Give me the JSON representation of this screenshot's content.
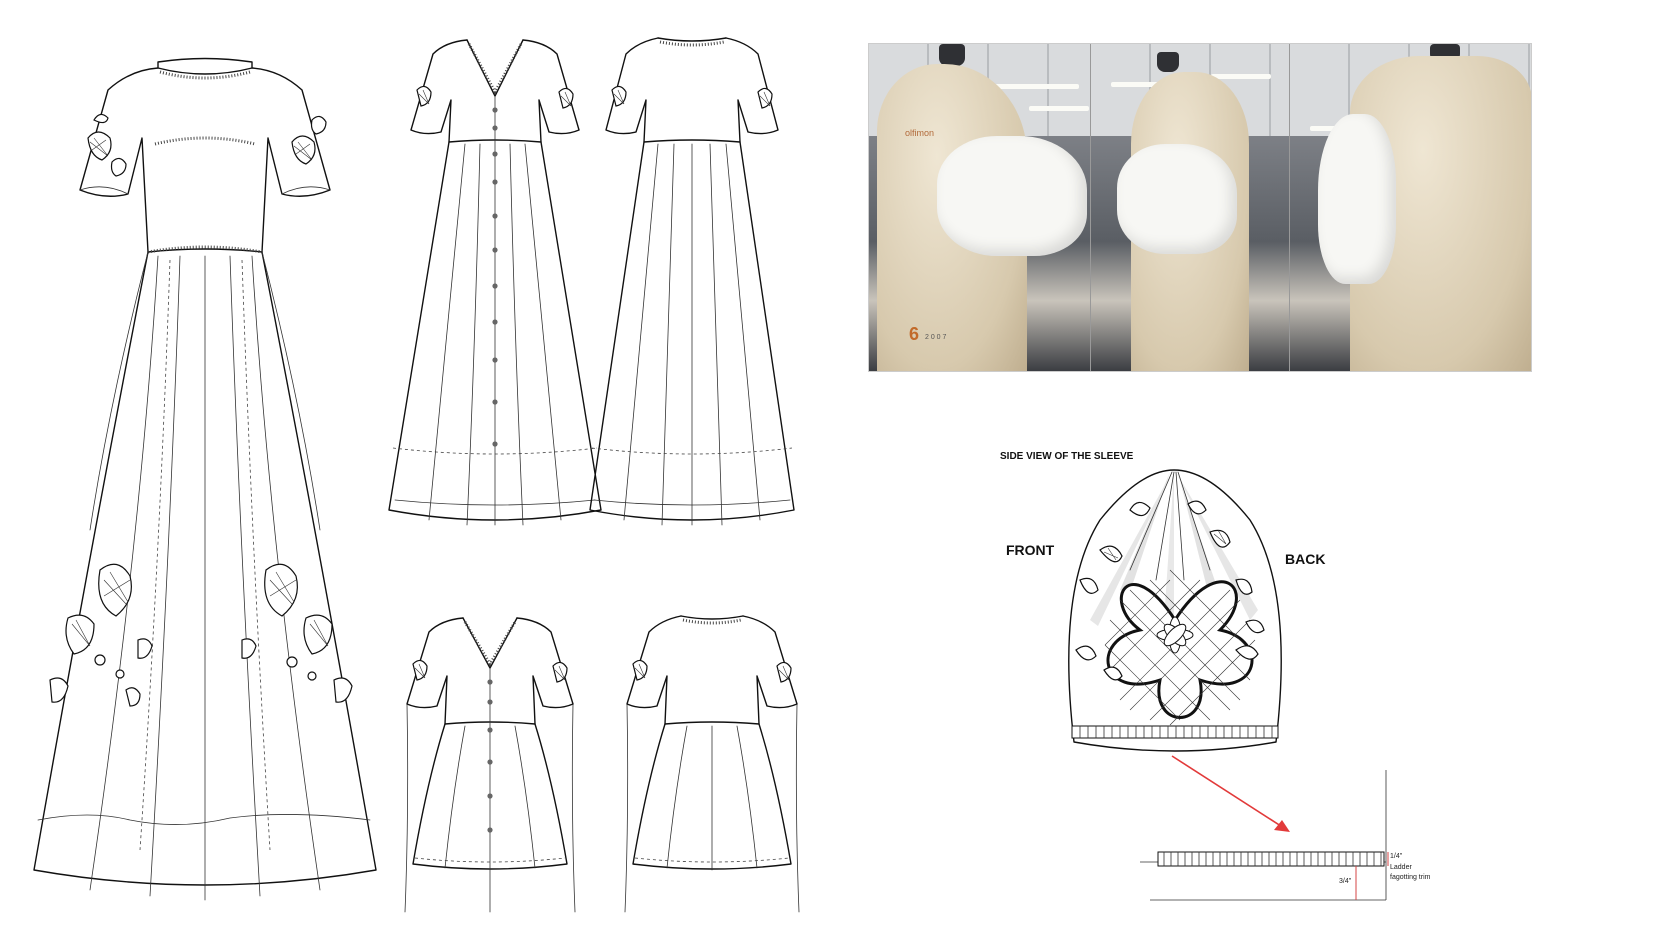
{
  "labels": {
    "side_view_title": "SIDE VIEW OF THE SLEEVE",
    "front": "FRONT",
    "back": "BACK"
  },
  "trim_callout": {
    "height_top": "1/4\"",
    "name_line1": "Ladder",
    "name_line2": "fagotting trim",
    "width_bottom": "3/4\""
  },
  "photo_strip": {
    "dressform_brand_partial": "olfimon",
    "dressform_number": "6",
    "dressform_year": "2 0 0 7"
  },
  "colors": {
    "arrow": "#e23a3a",
    "dimension_lines": "#d64545",
    "linework": "#111111"
  }
}
